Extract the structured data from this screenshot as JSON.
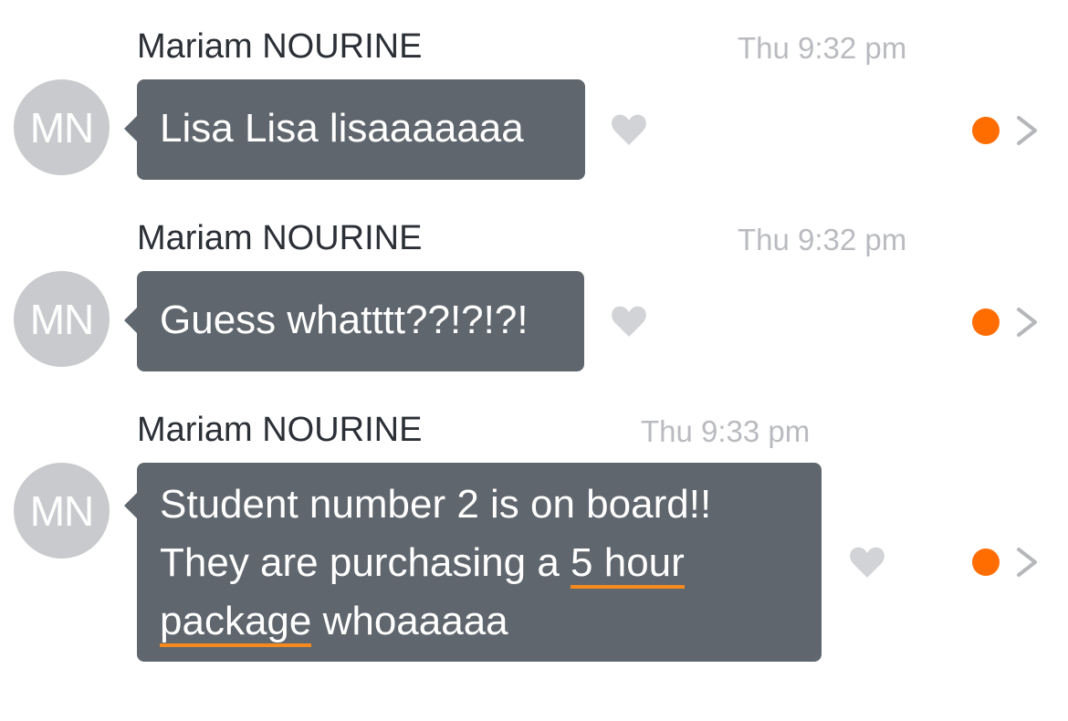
{
  "messages": [
    {
      "sender": "Mariam NOURINE",
      "time": "Thu 9:32 pm",
      "avatar_initials": "MN",
      "text": "Lisa Lisa lisaaaaaaa"
    },
    {
      "sender": "Mariam NOURINE",
      "time": "Thu 9:32 pm",
      "avatar_initials": "MN",
      "text": "Guess whatttt??!?!?!"
    },
    {
      "sender": "Mariam NOURINE",
      "time": "Thu 9:33 pm",
      "avatar_initials": "MN",
      "text_line1": "Student number 2 is on board!!",
      "text_line2_pre": "They are purchasing a ",
      "link_part1": "5 hour",
      "link_part2": "package",
      "text_line3_post": " whoaaaaa"
    }
  ],
  "icons": {
    "like": "heart-icon",
    "unread": "orange-dot-icon",
    "more": "chevron-right-icon"
  },
  "colors": {
    "bubble": "#5f666d",
    "avatar": "#c9cacd",
    "sender_text": "#2b2f36",
    "time_text": "#b9bbbf",
    "heart": "#d2d3d6",
    "unread_dot": "#ff6d00",
    "chevron": "#b5b7bb",
    "link_underline": "#f68a1e"
  }
}
